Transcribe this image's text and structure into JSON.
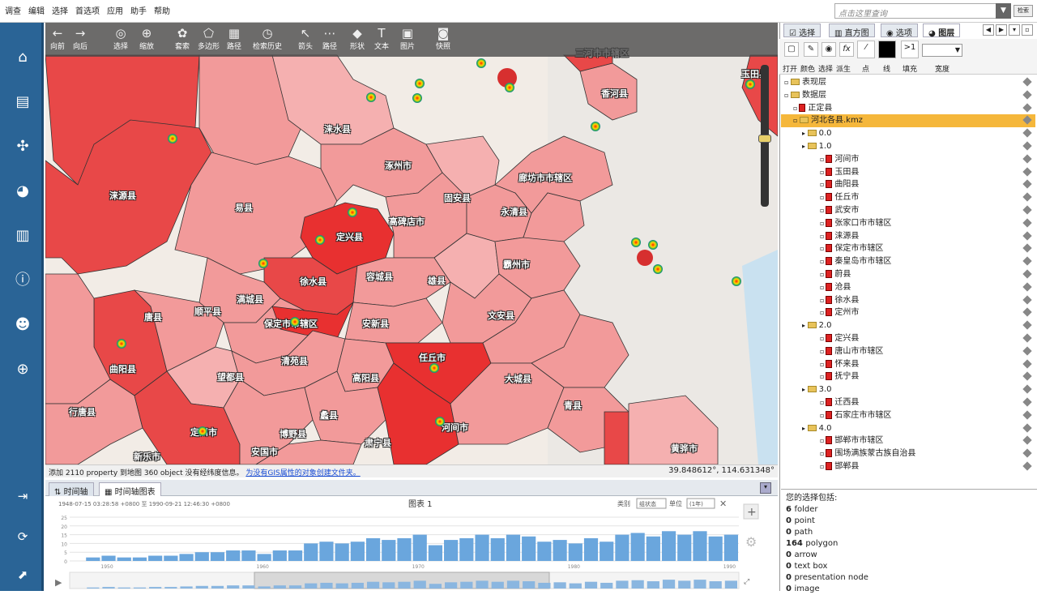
{
  "menu": [
    "调查",
    "编辑",
    "选择",
    "首选项",
    "应用",
    "助手",
    "帮助"
  ],
  "search": {
    "placeholder": "点击这里查询",
    "button": "检索"
  },
  "map_toolbar": [
    {
      "icon": "arrow-left-icon",
      "label": "向前"
    },
    {
      "icon": "arrow-right-icon",
      "label": "向后"
    },
    {
      "icon": "select-icon",
      "label": "选择"
    },
    {
      "icon": "zoom-icon",
      "label": "缩放"
    },
    {
      "icon": "lasso-icon",
      "label": "套索"
    },
    {
      "icon": "polygon-icon",
      "label": "多边形"
    },
    {
      "icon": "path-icon",
      "label": "路径"
    },
    {
      "icon": "history-icon",
      "label": "检索历史"
    },
    {
      "icon": "arrow-icon",
      "label": "箭头"
    },
    {
      "icon": "route-icon",
      "label": "路径"
    },
    {
      "icon": "shape-icon",
      "label": "形状"
    },
    {
      "icon": "text-icon",
      "label": "文本"
    },
    {
      "icon": "image-icon",
      "label": "图片"
    },
    {
      "icon": "camera-icon",
      "label": "快照"
    }
  ],
  "places": [
    {
      "name": "易县",
      "x": 300,
      "y": 255
    },
    {
      "name": "涞水县",
      "x": 415,
      "y": 158
    },
    {
      "name": "涞源县",
      "x": 150,
      "y": 240
    },
    {
      "name": "定兴县",
      "x": 430,
      "y": 291
    },
    {
      "name": "涿州市",
      "x": 490,
      "y": 203
    },
    {
      "name": "固安县",
      "x": 563,
      "y": 243
    },
    {
      "name": "高碑店市",
      "x": 500,
      "y": 272
    },
    {
      "name": "廊坊市市辖区",
      "x": 670,
      "y": 218
    },
    {
      "name": "永清县",
      "x": 633,
      "y": 260
    },
    {
      "name": "徐水县",
      "x": 385,
      "y": 346
    },
    {
      "name": "容城县",
      "x": 467,
      "y": 340
    },
    {
      "name": "雄县",
      "x": 538,
      "y": 345
    },
    {
      "name": "霸州市",
      "x": 636,
      "y": 325
    },
    {
      "name": "满城县",
      "x": 307,
      "y": 368
    },
    {
      "name": "顺平县",
      "x": 255,
      "y": 383
    },
    {
      "name": "唐县",
      "x": 188,
      "y": 390
    },
    {
      "name": "保定市市辖区",
      "x": 356,
      "y": 398
    },
    {
      "name": "安新县",
      "x": 462,
      "y": 398
    },
    {
      "name": "文安县",
      "x": 617,
      "y": 388
    },
    {
      "name": "清苑县",
      "x": 362,
      "y": 444
    },
    {
      "name": "任丘市",
      "x": 532,
      "y": 440
    },
    {
      "name": "曲阳县",
      "x": 150,
      "y": 454
    },
    {
      "name": "望都县",
      "x": 283,
      "y": 464
    },
    {
      "name": "高阳县",
      "x": 450,
      "y": 465
    },
    {
      "name": "大城县",
      "x": 638,
      "y": 466
    },
    {
      "name": "行唐县",
      "x": 100,
      "y": 507
    },
    {
      "name": "定州市",
      "x": 250,
      "y": 532
    },
    {
      "name": "蠡县",
      "x": 405,
      "y": 511
    },
    {
      "name": "青县",
      "x": 706,
      "y": 499
    },
    {
      "name": "博野县",
      "x": 360,
      "y": 534
    },
    {
      "name": "肃宁县",
      "x": 465,
      "y": 545
    },
    {
      "name": "河间市",
      "x": 560,
      "y": 526
    },
    {
      "name": "新乐市",
      "x": 180,
      "y": 562
    },
    {
      "name": "安国市",
      "x": 325,
      "y": 556
    },
    {
      "name": "黄骅市",
      "x": 843,
      "y": 552
    },
    {
      "name": "玉田县",
      "x": 930,
      "y": 90
    },
    {
      "name": "香河县",
      "x": 757,
      "y": 114
    },
    {
      "name": "三河市市辖区",
      "x": 740,
      "y": 64
    }
  ],
  "status": {
    "text": "添加 2110 property 到地图 360 object 没有经纬度信息。",
    "link": "为没有GIS属性的对象创建文件夹。",
    "coords": "39.848612°, 114.631348°"
  },
  "bottom_tabs": [
    "时间轴",
    "时间轴图表"
  ],
  "chart_data": {
    "type": "bar",
    "title": "图表 1",
    "range_text": "1948-07-15 03:28:58 +0800  至  1990-09-21 12:46:30 +0800",
    "category_label": "类别",
    "category_value": "组状态",
    "unit_label": "单位",
    "unit_value": "(1年)",
    "xticks": [
      "1950",
      "1960",
      "1970",
      "1980",
      "1990"
    ],
    "yticks": [
      0,
      5,
      10,
      15,
      20,
      25
    ],
    "ylim": [
      0,
      25
    ],
    "x": [
      1948,
      1949,
      1950,
      1951,
      1952,
      1953,
      1954,
      1955,
      1956,
      1957,
      1958,
      1959,
      1960,
      1961,
      1962,
      1963,
      1964,
      1965,
      1966,
      1967,
      1968,
      1969,
      1970,
      1971,
      1972,
      1973,
      1974,
      1975,
      1976,
      1977,
      1978,
      1979,
      1980,
      1981,
      1982,
      1983,
      1984,
      1985,
      1986,
      1987,
      1988,
      1989,
      1990
    ],
    "values": [
      0,
      2,
      3,
      2,
      2,
      3,
      3,
      4,
      5,
      5,
      6,
      6,
      4,
      6,
      6,
      10,
      11,
      10,
      11,
      13,
      12,
      13,
      15,
      9,
      12,
      13,
      15,
      13,
      15,
      14,
      11,
      12,
      10,
      13,
      11,
      15,
      16,
      14,
      17,
      15,
      17,
      14,
      15
    ]
  },
  "right_tabs": [
    "选择",
    "直方图",
    "选项",
    "图层"
  ],
  "right_tools": [
    "打开",
    "颜色",
    "选择",
    "派生",
    "点",
    "线",
    "填充",
    "宽度"
  ],
  "fill_value": ">1",
  "tree": [
    {
      "label": "表现层",
      "indent": 0,
      "type": "folder"
    },
    {
      "label": "数据层",
      "indent": 0,
      "type": "folder"
    },
    {
      "label": "正定县",
      "indent": 1,
      "type": "kml"
    },
    {
      "label": "河北各县.kmz",
      "indent": 1,
      "type": "folder",
      "selected": true
    },
    {
      "label": "0.0",
      "indent": 2,
      "type": "folder"
    },
    {
      "label": "1.0",
      "indent": 2,
      "type": "folder"
    },
    {
      "label": "河间市",
      "indent": 4,
      "type": "kml"
    },
    {
      "label": "玉田县",
      "indent": 4,
      "type": "kml"
    },
    {
      "label": "曲阳县",
      "indent": 4,
      "type": "kml"
    },
    {
      "label": "任丘市",
      "indent": 4,
      "type": "kml"
    },
    {
      "label": "武安市",
      "indent": 4,
      "type": "kml"
    },
    {
      "label": "张家口市市辖区",
      "indent": 4,
      "type": "kml"
    },
    {
      "label": "涞源县",
      "indent": 4,
      "type": "kml"
    },
    {
      "label": "保定市市辖区",
      "indent": 4,
      "type": "kml"
    },
    {
      "label": "秦皇岛市市辖区",
      "indent": 4,
      "type": "kml"
    },
    {
      "label": "蔚县",
      "indent": 4,
      "type": "kml"
    },
    {
      "label": "沧县",
      "indent": 4,
      "type": "kml"
    },
    {
      "label": "徐水县",
      "indent": 4,
      "type": "kml"
    },
    {
      "label": "定州市",
      "indent": 4,
      "type": "kml"
    },
    {
      "label": "2.0",
      "indent": 2,
      "type": "folder"
    },
    {
      "label": "定兴县",
      "indent": 4,
      "type": "kml"
    },
    {
      "label": "唐山市市辖区",
      "indent": 4,
      "type": "kml"
    },
    {
      "label": "怀来县",
      "indent": 4,
      "type": "kml"
    },
    {
      "label": "抚宁县",
      "indent": 4,
      "type": "kml"
    },
    {
      "label": "3.0",
      "indent": 2,
      "type": "folder"
    },
    {
      "label": "迁西县",
      "indent": 4,
      "type": "kml"
    },
    {
      "label": "石家庄市市辖区",
      "indent": 4,
      "type": "kml"
    },
    {
      "label": "4.0",
      "indent": 2,
      "type": "folder"
    },
    {
      "label": "邯郸市市辖区",
      "indent": 4,
      "type": "kml"
    },
    {
      "label": "围场满族蒙古族自治县",
      "indent": 4,
      "type": "kml"
    },
    {
      "label": "邯郸县",
      "indent": 4,
      "type": "kml"
    }
  ],
  "selection": {
    "title": "您的选择包括:",
    "rows": [
      {
        "count": "6",
        "label": "folder"
      },
      {
        "count": "0",
        "label": "point"
      },
      {
        "count": "0",
        "label": "path"
      },
      {
        "count": "164",
        "label": "polygon"
      },
      {
        "count": "0",
        "label": "arrow"
      },
      {
        "count": "0",
        "label": "text box"
      },
      {
        "count": "0",
        "label": "presentation node"
      },
      {
        "count": "0",
        "label": "image"
      }
    ]
  }
}
